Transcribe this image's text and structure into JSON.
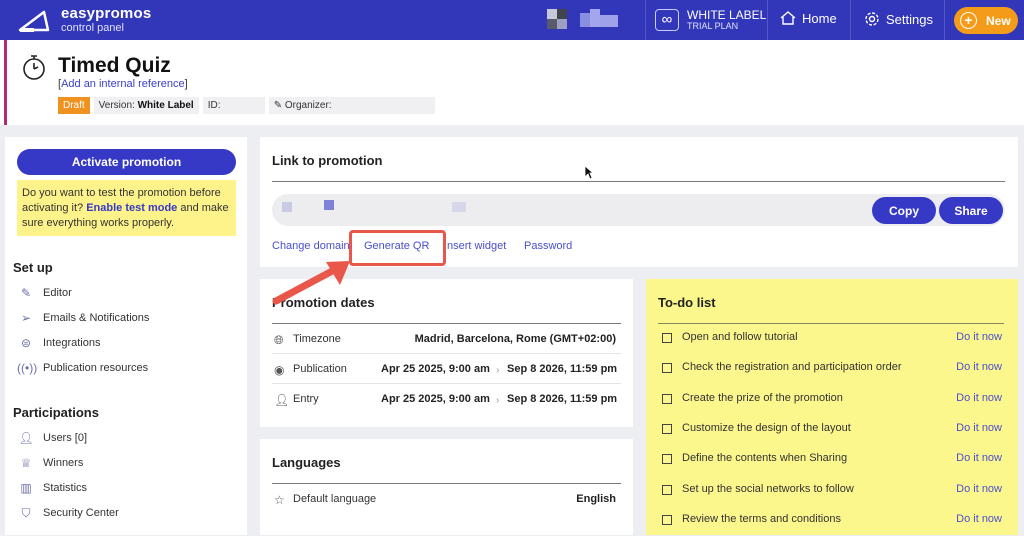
{
  "topbar": {
    "brand": "easypromos",
    "brand_sub": "control panel",
    "plan_title": "WHITE LABEL",
    "plan_sub": "TRIAL PLAN",
    "plan_icon": "∞",
    "home": "Home",
    "settings": "Settings",
    "new": "New",
    "bg_color": "#3236b8",
    "new_color": "#f59b1a"
  },
  "header": {
    "title": "Timed Quiz",
    "internal_ref": "Add an internal reference",
    "draft": "Draft",
    "version_label": "Version:",
    "version_value": "White Label",
    "id_label": "ID:",
    "organizer_label": "Organizer:"
  },
  "sidebar": {
    "activate": "Activate promotion",
    "note_before": "Do you want to test the promotion before activating it?",
    "note_link": "Enable test mode",
    "note_after": "and make sure everything works properly.",
    "setup_title": "Set up",
    "setup_items": [
      "Editor",
      "Emails & Notifications",
      "Integrations",
      "Publication resources"
    ],
    "part_title": "Participations",
    "part_items": [
      "Users [0]",
      "Winners",
      "Statistics",
      "Security Center"
    ]
  },
  "link_card": {
    "title": "Link to promotion",
    "copy": "Copy",
    "share": "Share",
    "actions": [
      "Change domain",
      "Generate QR",
      "nsert widget",
      "Password"
    ]
  },
  "dates_card": {
    "title": "Promotion dates",
    "timezone_label": "Timezone",
    "timezone_value": "Madrid, Barcelona, Rome (GMT+02:00)",
    "publication_label": "Publication",
    "publication_start": "Apr 25 2025, 9:00 am",
    "publication_end": "Sep 8 2026, 11:59 pm",
    "entry_label": "Entry",
    "entry_start": "Apr 25 2025, 9:00 am",
    "entry_end": "Sep 8 2026, 11:59 pm"
  },
  "languages_card": {
    "title": "Languages",
    "default_label": "Default language",
    "default_value": "English"
  },
  "todo": {
    "title": "To-do list",
    "action": "Do it now",
    "items": [
      "Open and follow tutorial",
      "Check the registration and participation order",
      "Create the prize of the promotion",
      "Customize the design of the layout",
      "Define the contents when Sharing",
      "Set up the social networks to follow",
      "Review the terms and conditions"
    ]
  },
  "colors": {
    "accent": "#3539c6",
    "highlight": "#e8574a",
    "todo_bg": "#fcf78d"
  }
}
